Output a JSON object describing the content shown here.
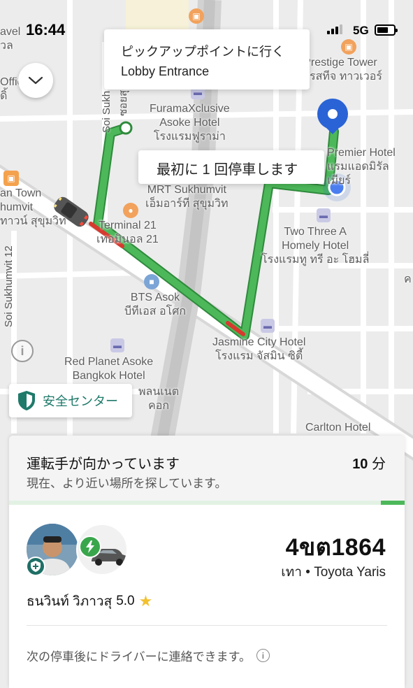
{
  "status_bar": {
    "time": "16:44",
    "network": "5G"
  },
  "callouts": {
    "pickup_line1": "ピックアップポイントに行く",
    "pickup_line2": "Lobby Entrance",
    "stop": "最初に 1 回停車します"
  },
  "map_labels": {
    "prestige_en": "Prestige Tower",
    "prestige_th": "เพรสทีจ ทาวเวอร์",
    "furama_en1": "FuramaXclusive",
    "furama_en2": "Asoke Hotel",
    "furama_th": "โรงแรมฟูราม่า",
    "premier_en": "Premier Hotel",
    "premier_th1": "แรมแอดมิรัล",
    "premier_th2": "เมียร์",
    "mrt_en": "MRT Sukhumvit",
    "mrt_th": "เอ็มอาร์ที สุขุมวิท",
    "terminal_en": "Terminal 21",
    "terminal_th": "เทอมินอล 21",
    "two_three_en1": "Two Three A",
    "two_three_en2": "Homely Hotel",
    "two_three_th": "โรงแรมทู ทรี อะ โฮมลี่",
    "bts_en": "BTS Asok",
    "bts_th": "บีทีเอส อโศก",
    "jasmine_en": "Jasmine City Hotel",
    "jasmine_th": "โรงแรม จัสมิน ซิตี้",
    "red_planet_en1": "Red Planet Asoke",
    "red_planet_en2": "Bangkok Hotel",
    "red_planet_th1": "พลนเนต",
    "red_planet_th2": "คอก",
    "carlton_en": "Carlton Hotel",
    "town_en1": "an Town",
    "town_en2": "humvit",
    "town_th": "ทาวน์ สุขุมวิท",
    "travel_en": "avel",
    "travel_th": "วล",
    "office_en": "Offic",
    "office_th": "ดิ้",
    "soi_sukhumvit": "Soi Sukh",
    "soi_sukhumvit_th": "ซอยสุข",
    "soi_sukhumvit_12": "Soi Sukhumvit 12",
    "edge_right": "ค"
  },
  "colors": {
    "route": "#4cb85a",
    "route_dark": "#2f8a3c",
    "traffic_red": "#d63a2f",
    "destination_pin": "#2a63d6",
    "accent_teal": "#1f7a6a"
  },
  "safety": {
    "label": "安全センター"
  },
  "trip": {
    "title": "運転手が向かっています",
    "eta_value": "10",
    "eta_unit": "分",
    "subtitle": "現在、より近い場所を探しています。",
    "progress_percent": 6
  },
  "driver": {
    "name": "ธนวินท์ วิภาวสุ",
    "rating": "5.0",
    "plate": "4ขต1864",
    "vehicle": "เทา • Toyota Yaris"
  },
  "contact_note": "次の停車後にドライバーに連絡できます。",
  "icons": {
    "collapse": "chevron-down-icon",
    "info": "info-icon",
    "shield": "shield-icon",
    "star": "star-icon",
    "ev": "lightning-icon"
  }
}
